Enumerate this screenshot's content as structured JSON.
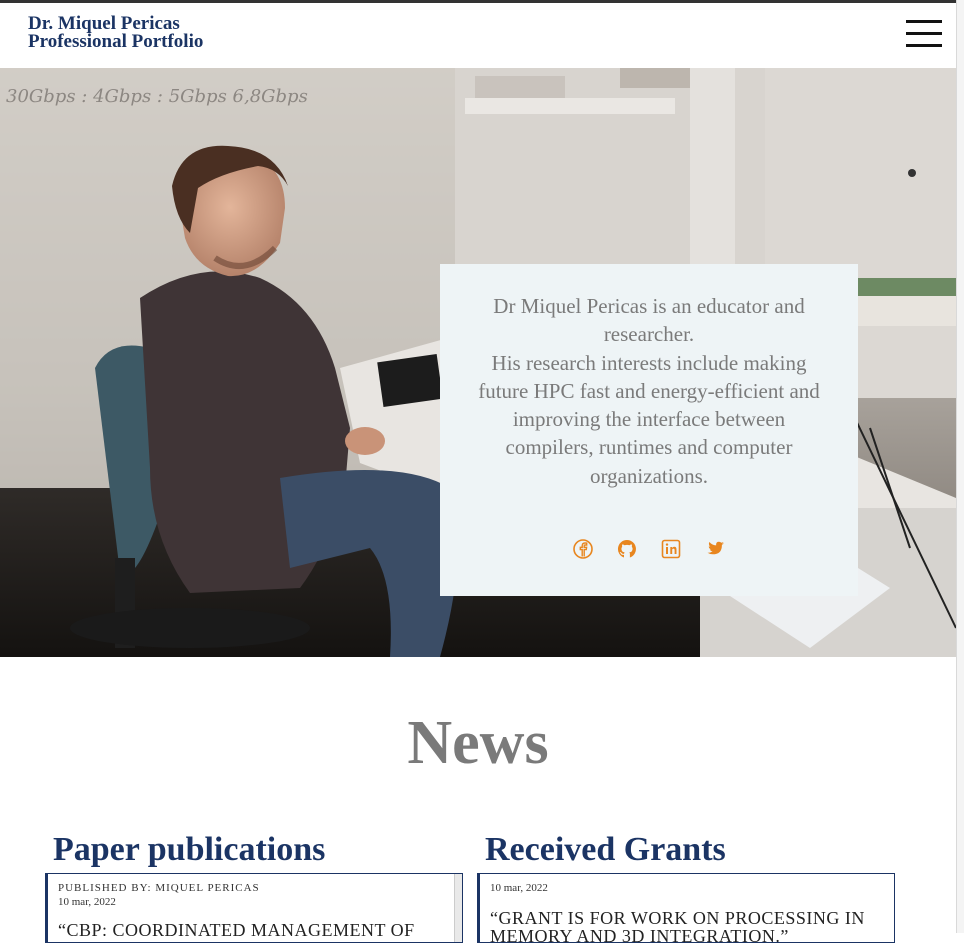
{
  "header": {
    "title_line1": "Dr. Miquel Pericas",
    "title_line2": "Professional Portfolio",
    "menu_icon": "hamburger-menu-icon"
  },
  "hero": {
    "whiteboard_scribble": "30Gbps : 4Gbps : 5Gbps    6,8Gbps",
    "intro_line1": "Dr Miquel Pericas is an educator and researcher.",
    "intro_line2": "His research interests include making future HPC fast and energy-efficient and improving the interface between compilers, runtimes and computer organizations.",
    "social_icons": [
      "facebook-icon",
      "github-icon",
      "linkedin-icon",
      "twitter-icon"
    ],
    "accent_color": "#e8861f"
  },
  "news": {
    "title": "News",
    "publications": {
      "heading": "Paper publications",
      "meta": "Published by: Miquel Pericas",
      "date": "10 mar, 2022",
      "headline": "“CBP: Coordinated management of"
    },
    "grants": {
      "heading": "Received Grants",
      "date": "10 mar, 2022",
      "headline": "“Grant is for work on processing in",
      "headline2": "memory and 3D integration.”"
    }
  },
  "colors": {
    "brand_navy": "#1b3464",
    "text_gray": "#7a7a7a",
    "card_bg": "#eef4f6"
  }
}
